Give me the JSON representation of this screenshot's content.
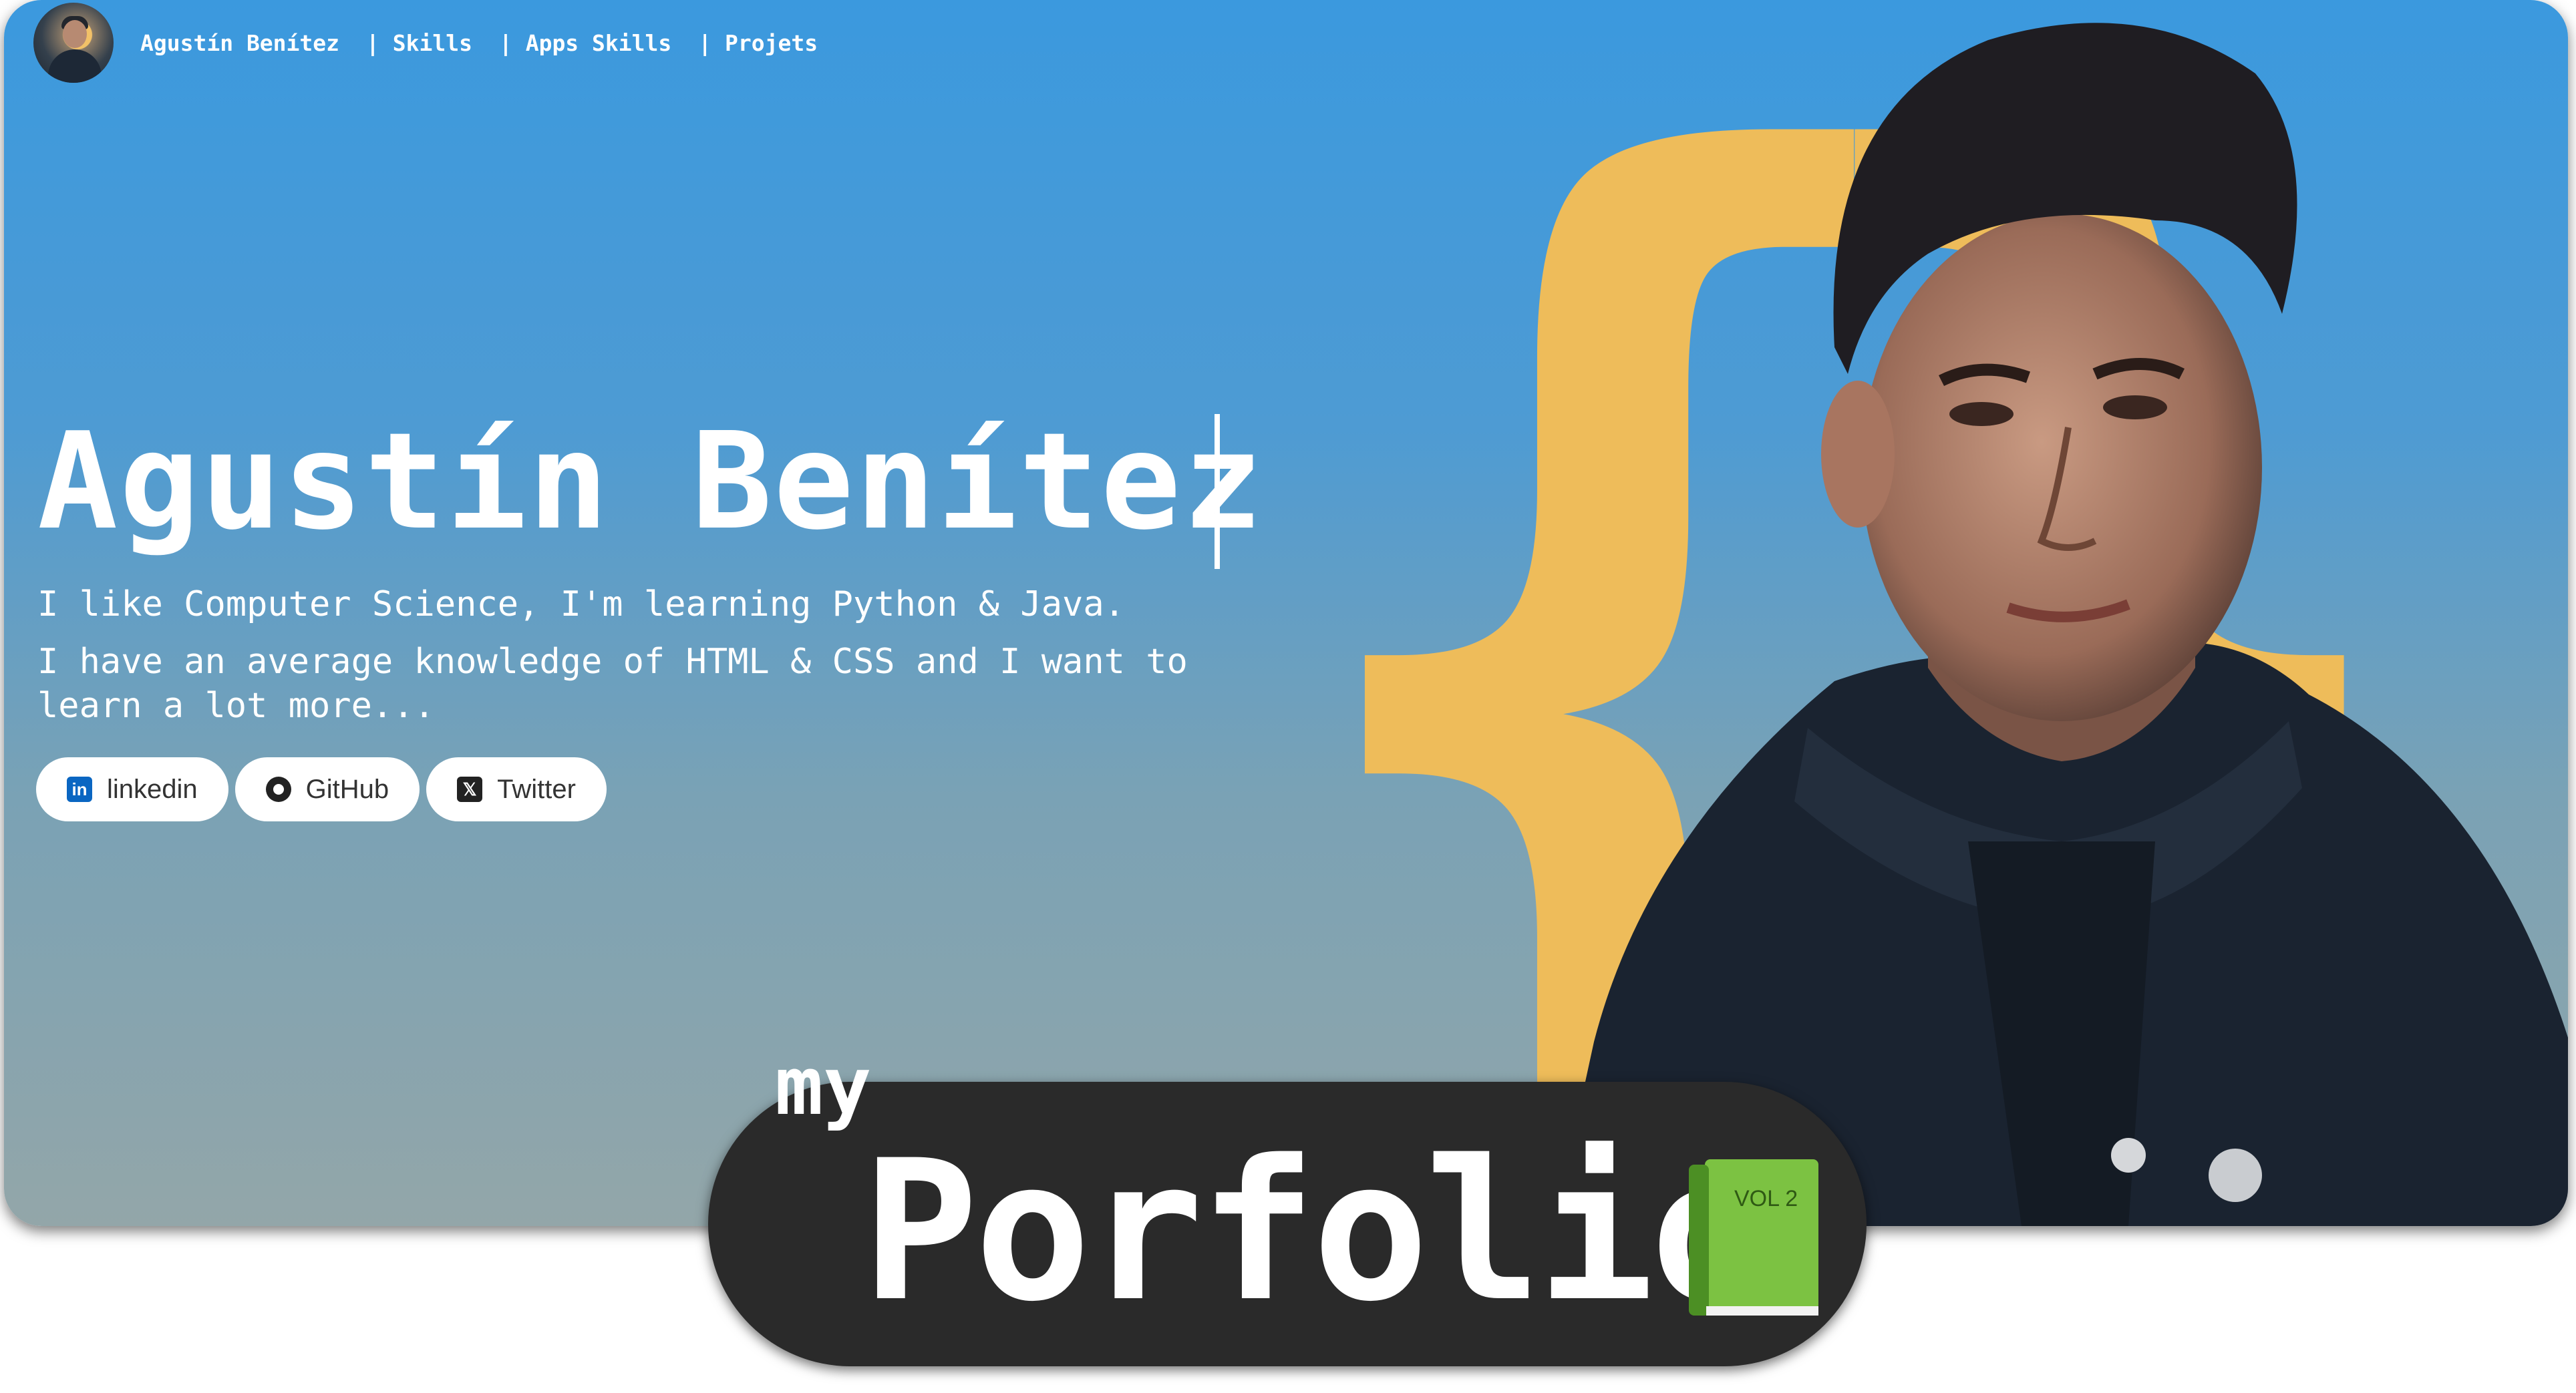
{
  "nav": {
    "name": "Agustín Benítez",
    "links": [
      "| Skills",
      "| Apps Skills",
      "| Projets"
    ]
  },
  "hero": {
    "name": "Agustín Benítez",
    "line1": "I like Computer Science, I'm learning Python & Java.",
    "line2": "I have an average knowledge of HTML & CSS and I want to learn a lot more...",
    "socials": [
      {
        "label": "linkedin",
        "icon": "linkedin-icon"
      },
      {
        "label": "GitHub",
        "icon": "github-icon"
      },
      {
        "label": "Twitter",
        "icon": "x-icon"
      }
    ]
  },
  "banner": {
    "prefix": "my",
    "title": "Porfolio",
    "book_label": "VOL 2"
  },
  "colors": {
    "accent_brace": "#eebc5a",
    "banner_bg": "#2a2a2a",
    "book_green": "#7cc242"
  }
}
